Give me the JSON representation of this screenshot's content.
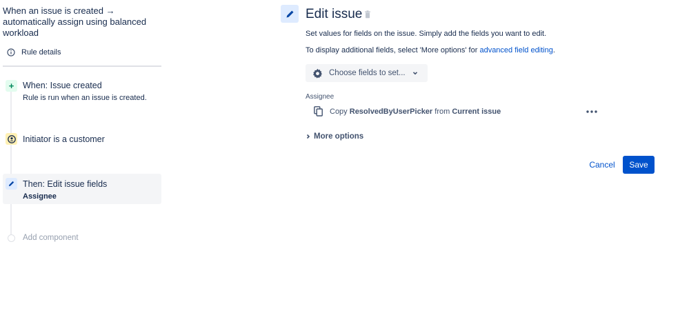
{
  "sidebar": {
    "rule_title": "When an issue is created → automatically assign using balanced workload",
    "rule_details_label": "Rule details",
    "components": {
      "trigger": {
        "title": "When: Issue created",
        "subtitle": "Rule is run when an issue is created.",
        "icon": "plus-icon"
      },
      "condition": {
        "title": "Initiator is a customer",
        "icon": "customer-icon"
      },
      "action": {
        "title": "Then: Edit issue fields",
        "subtitle": "Assignee",
        "icon": "pencil-icon"
      },
      "add": {
        "title": "Add component"
      }
    }
  },
  "main": {
    "title": "Edit issue",
    "description_1": "Set values for fields on the issue. Simply add the fields you want to edit.",
    "description_2_prefix": "To display additional fields, select 'More options' for ",
    "description_2_link": "advanced field editing",
    "description_2_suffix": ".",
    "choose_fields_label": "Choose fields to set...",
    "field": {
      "label": "Assignee",
      "copy_prefix": "Copy ",
      "copy_source_field": "ResolvedByUserPicker",
      "copy_middle": " from ",
      "copy_source_issue": "Current issue"
    },
    "more_options_label": "More options",
    "cancel_label": "Cancel",
    "save_label": "Save"
  },
  "colors": {
    "primary": "#0052cc",
    "text": "#172b4d",
    "subtle_text": "#42526e",
    "trigger_bg": "#e3fcef",
    "condition_bg": "#fff0b3",
    "action_bg": "#deebff"
  }
}
